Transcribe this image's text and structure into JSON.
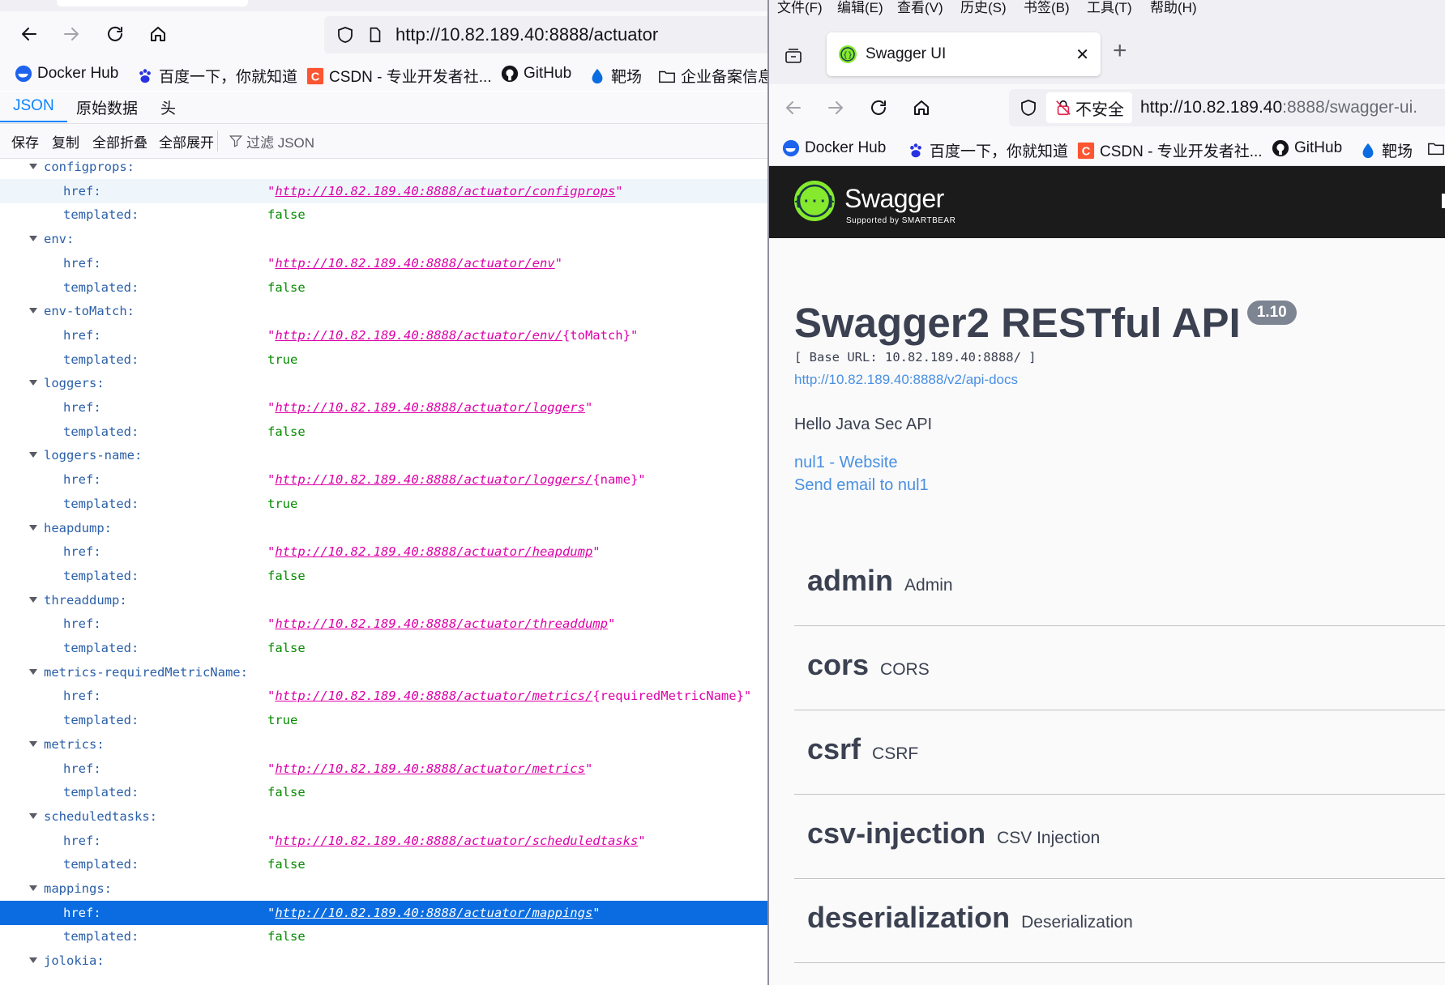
{
  "left": {
    "url": "http://10.82.189.40:8888/actuator",
    "bookmarks": [
      "Docker Hub",
      "百度一下，你就知道",
      "CSDN - 专业开发者社...",
      "GitHub",
      "靶场",
      "企业备案信息"
    ],
    "tabs": [
      "JSON",
      "原始数据",
      "头"
    ],
    "toolbar": {
      "save": "保存",
      "copy": "复制",
      "collapse_all": "全部折叠",
      "expand_all": "全部展开",
      "filter_placeholder": "过滤 JSON"
    },
    "entries": [
      {
        "name": "configprops:",
        "href": "http://10.82.189.40:8888/actuator/configprops",
        "href_suffix": "",
        "templated": "false"
      },
      {
        "name": "env:",
        "href": "http://10.82.189.40:8888/actuator/env",
        "href_suffix": "",
        "templated": "false"
      },
      {
        "name": "env-toMatch:",
        "href": "http://10.82.189.40:8888/actuator/env/",
        "href_suffix": "{toMatch}",
        "templated": "true"
      },
      {
        "name": "loggers:",
        "href": "http://10.82.189.40:8888/actuator/loggers",
        "href_suffix": "",
        "templated": "false"
      },
      {
        "name": "loggers-name:",
        "href": "http://10.82.189.40:8888/actuator/loggers/",
        "href_suffix": "{name}",
        "templated": "true"
      },
      {
        "name": "heapdump:",
        "href": "http://10.82.189.40:8888/actuator/heapdump",
        "href_suffix": "",
        "templated": "false"
      },
      {
        "name": "threaddump:",
        "href": "http://10.82.189.40:8888/actuator/threaddump",
        "href_suffix": "",
        "templated": "false"
      },
      {
        "name": "metrics-requiredMetricName:",
        "href": "http://10.82.189.40:8888/actuator/metrics/",
        "href_suffix": "{requiredMetricName}",
        "templated": "true"
      },
      {
        "name": "metrics:",
        "href": "http://10.82.189.40:8888/actuator/metrics",
        "href_suffix": "",
        "templated": "false"
      },
      {
        "name": "scheduledtasks:",
        "href": "http://10.82.189.40:8888/actuator/scheduledtasks",
        "href_suffix": "",
        "templated": "false"
      },
      {
        "name": "mappings:",
        "href": "http://10.82.189.40:8888/actuator/mappings",
        "href_suffix": "",
        "templated": "false"
      }
    ],
    "last_key": "jolokia:",
    "href_key": "href:",
    "templated_key": "templated:"
  },
  "right": {
    "menu": [
      "文件(F)",
      "编辑(E)",
      "查看(V)",
      "历史(S)",
      "书签(B)",
      "工具(T)",
      "帮助(H)"
    ],
    "tab_title": "Swagger UI",
    "insecure_label": "不安全",
    "url_prefix": "http://10.82.189.40",
    "url_rest": ":8888/swagger-ui.",
    "bookmarks": [
      "Docker Hub",
      "百度一下，你就知道",
      "CSDN - 专业开发者社...",
      "GitHub",
      "靶场"
    ],
    "swagger": {
      "logo_text": "Swagger",
      "logo_sub": "Supported by SMARTBEAR",
      "title": "Swagger2 RESTful API",
      "version": "1.10",
      "base_url": "[ Base URL: 10.82.189.40:8888/ ]",
      "api_docs": "http://10.82.189.40:8888/v2/api-docs",
      "description": "Hello Java Sec API",
      "website_link": "nul1 - Website",
      "email_link": "Send email to nul1",
      "tags": [
        {
          "name": "admin",
          "desc": "Admin"
        },
        {
          "name": "cors",
          "desc": "CORS"
        },
        {
          "name": "csrf",
          "desc": "CSRF"
        },
        {
          "name": "csv-injection",
          "desc": "CSV Injection"
        },
        {
          "name": "deserialization",
          "desc": "Deserialization"
        }
      ]
    }
  }
}
